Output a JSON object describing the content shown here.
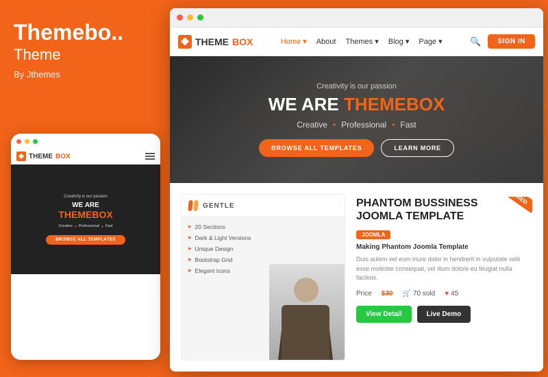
{
  "left": {
    "title": "Themebo..",
    "subtitle": "Theme",
    "by": "By Jthemes"
  },
  "mobile": {
    "passion": "Creativity is our passion",
    "weAre": "WE ARE",
    "themebox": "THEMEBOX",
    "tagline": [
      "Creative",
      "Professional",
      "Fast"
    ],
    "browseBtn": "BROWSE ALL TEMPLATES"
  },
  "browser": {
    "navbar": {
      "brandTheme": "THEME",
      "brandBox": "BOX",
      "nav": [
        {
          "label": "Home",
          "active": true
        },
        {
          "label": "About"
        },
        {
          "label": "Themes"
        },
        {
          "label": "Blog"
        },
        {
          "label": "Page"
        }
      ],
      "signinLabel": "SIGN IN"
    },
    "hero": {
      "passion": "Creativity is our passion",
      "titleWhite": "WE ARE",
      "titleOrange": "THEMEBOX",
      "tagline": [
        "Creative",
        "Professional",
        "Fast"
      ],
      "browseBtn": "BROWSE ALL TEMPLATES",
      "learnBtn": "LEARN MORE"
    },
    "product": {
      "brandName": "GENTLE",
      "features": [
        "20 Sections",
        "Dark & Light Versions",
        "Unique Design",
        "Bootstrap Grid",
        "Elegant Icons"
      ],
      "title": "PHANTOM BUSSINESS\nJOOMLA TEMPLATE",
      "badge": "JOOMLA",
      "subtitle": "Making Phantom Joomla Template",
      "desc": "Duis autem vel eum iriure dolor in hendrerit in vulputate velit esse molestie consequat, vel illum dolore eu feugiat nulla facilisis.",
      "priceLabel": "Price",
      "priceOld": "$30",
      "soldLabel": "70 sold",
      "heartLabel": "45",
      "viewDetailBtn": "View Detail",
      "liveDemoBtn": "Live Demo",
      "featuredLabel": "FEATURED"
    }
  }
}
